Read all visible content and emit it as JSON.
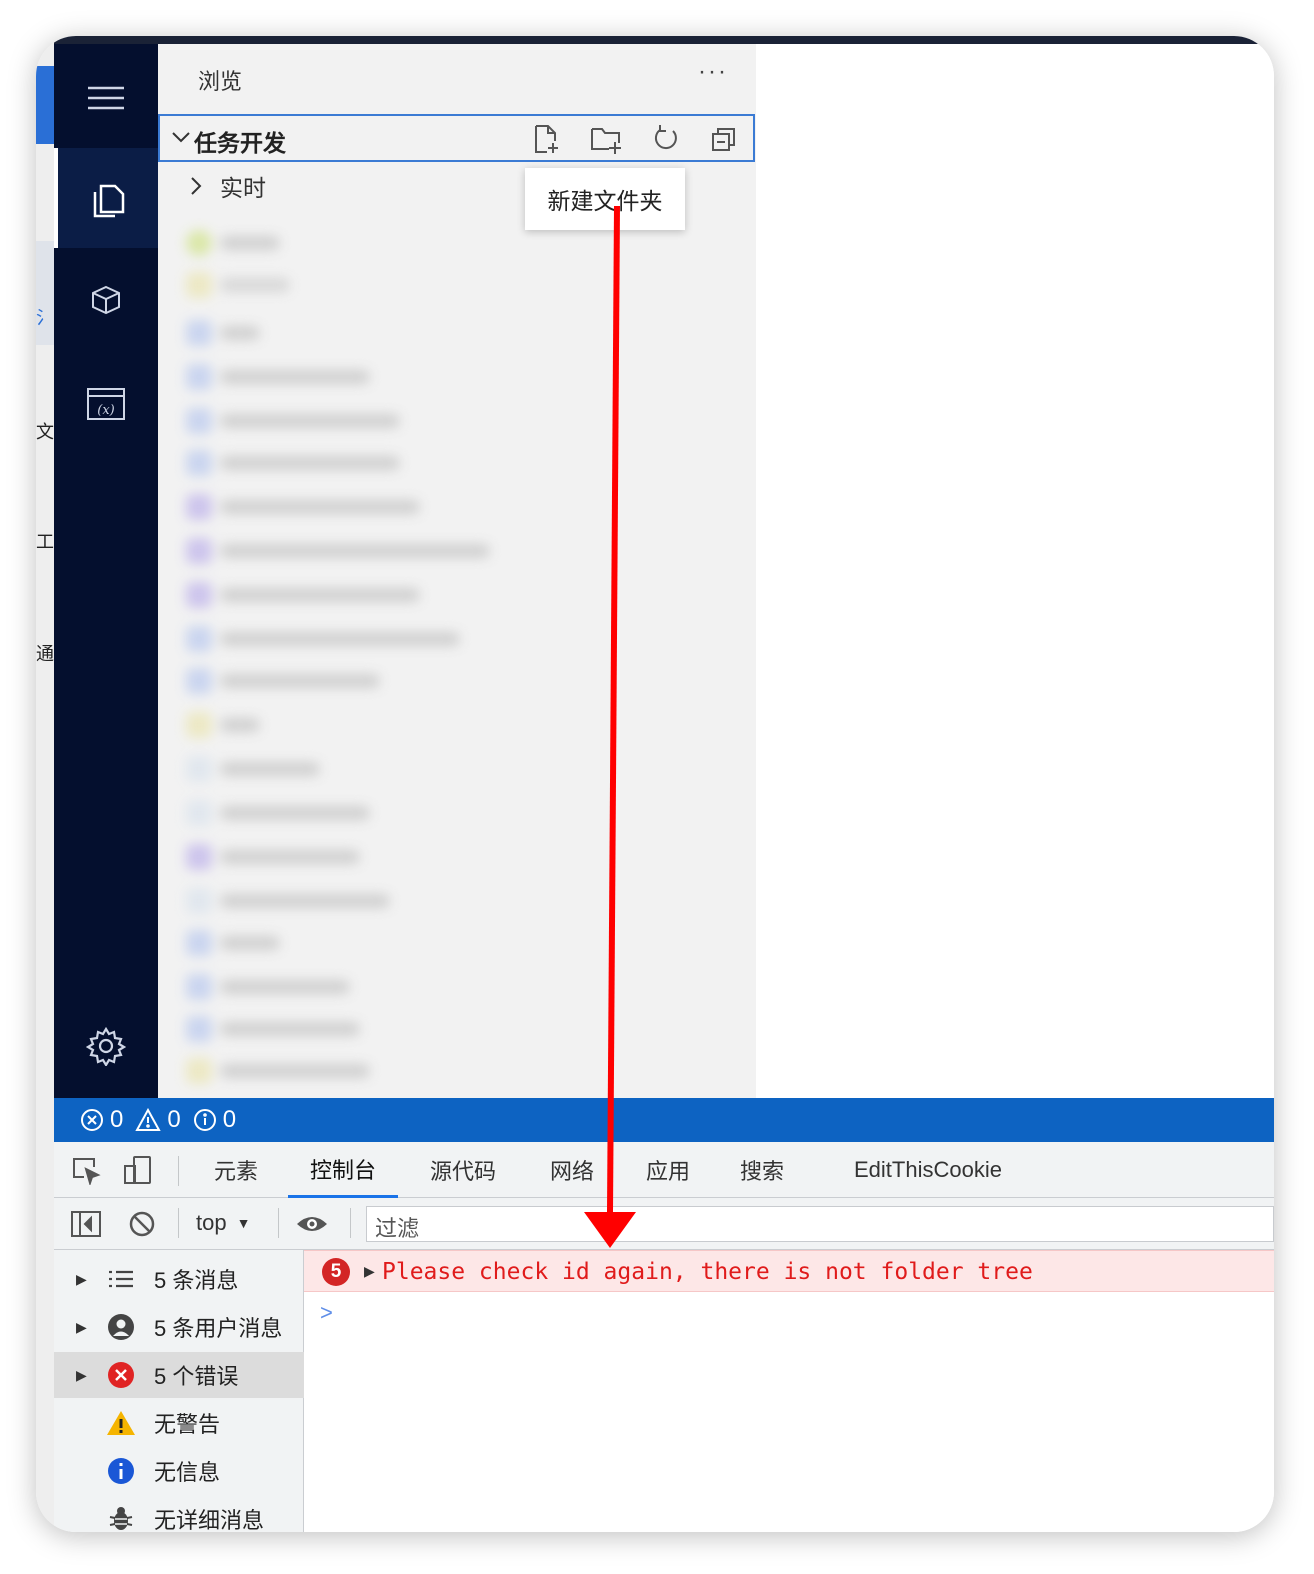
{
  "left_strip": {
    "fragments": [
      "氵",
      "文",
      "工",
      "通"
    ]
  },
  "sidebar": {
    "title": "浏览",
    "more": "···",
    "section": {
      "title": "任务开发"
    },
    "tree": [
      {
        "label": "实时"
      }
    ]
  },
  "tooltip": {
    "text": "新建文件夹"
  },
  "statusbar": {
    "errors": "0",
    "warnings": "0",
    "infos": "0"
  },
  "devtools": {
    "tabs": [
      "元素",
      "控制台",
      "源代码",
      "网络",
      "应用",
      "搜索",
      "EditThisCookie"
    ],
    "active_tab": "控制台",
    "context": "top",
    "filter_placeholder": "过滤",
    "sidebar_items": [
      {
        "label": "5 条消息"
      },
      {
        "label": "5 条用户消息"
      },
      {
        "label": "5 个错误"
      },
      {
        "label": "无警告"
      },
      {
        "label": "无信息"
      },
      {
        "label": "无详细消息"
      }
    ],
    "console": {
      "error_count": "5",
      "error_message": "Please check id again, there is not folder tree",
      "prompt": ">"
    }
  },
  "colors": {
    "activitybar": "#040f2e",
    "statusbar": "#0d63c2",
    "error": "#e01b1b",
    "annotation_arrow": "#ff0000"
  }
}
